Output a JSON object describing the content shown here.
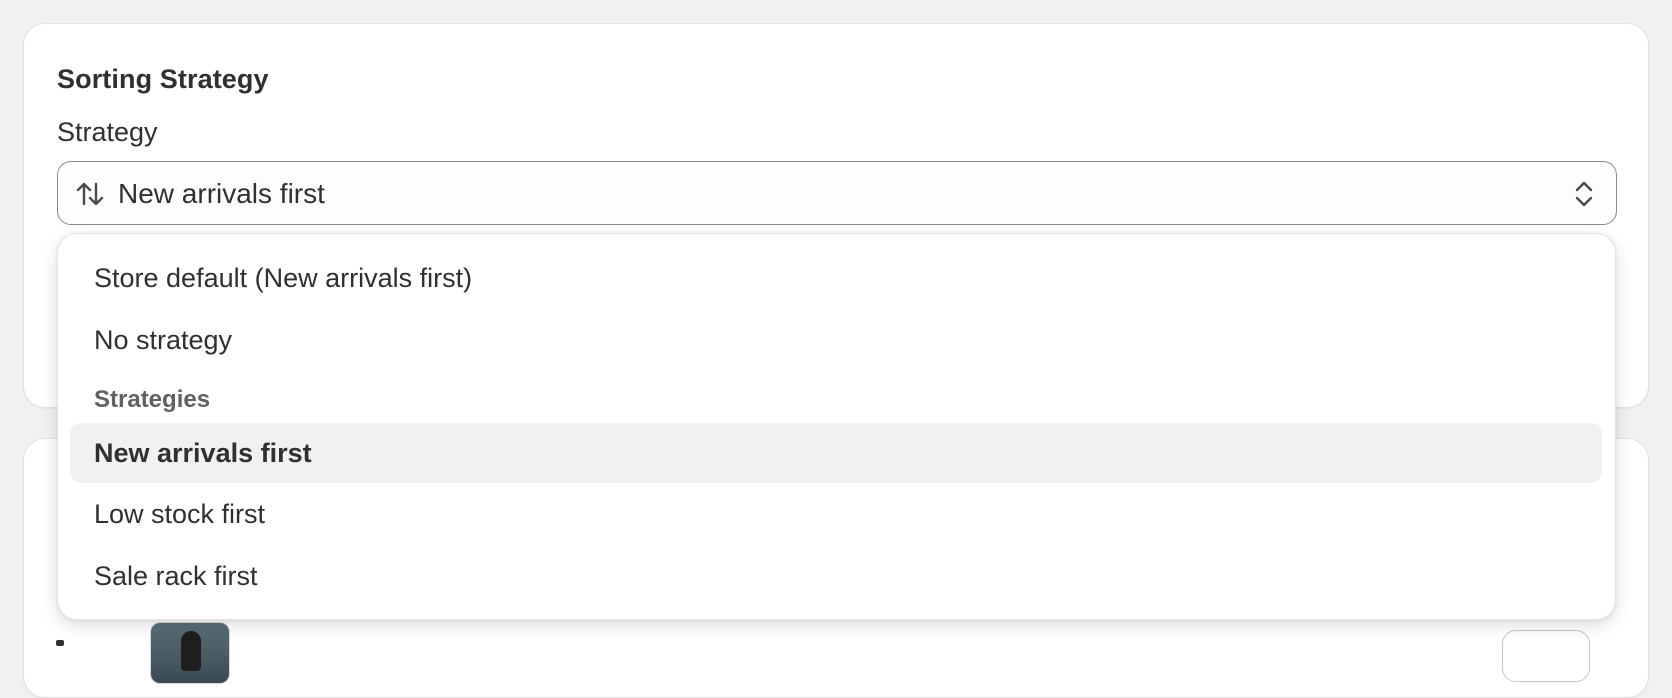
{
  "card": {
    "title": "Sorting Strategy"
  },
  "field": {
    "label": "Strategy",
    "selected_value": "New arrivals first",
    "leading_icon": "sort-arrows-icon",
    "trailing_icon": "chevron-up-down-icon"
  },
  "dropdown": {
    "options_top": [
      {
        "label": "Store default (New arrivals first)"
      },
      {
        "label": "No strategy"
      }
    ],
    "section_heading": "Strategies",
    "options_strategies": [
      {
        "label": "New arrivals first",
        "selected": true
      },
      {
        "label": "Low stock first",
        "selected": false
      },
      {
        "label": "Sale rack first",
        "selected": false
      }
    ]
  },
  "colors": {
    "page_bg": "#f1f1f1",
    "card_bg": "#ffffff",
    "text": "#303030",
    "muted_text": "#616161",
    "selected_bg": "#f1f1f1",
    "border": "#8a8a8a"
  }
}
